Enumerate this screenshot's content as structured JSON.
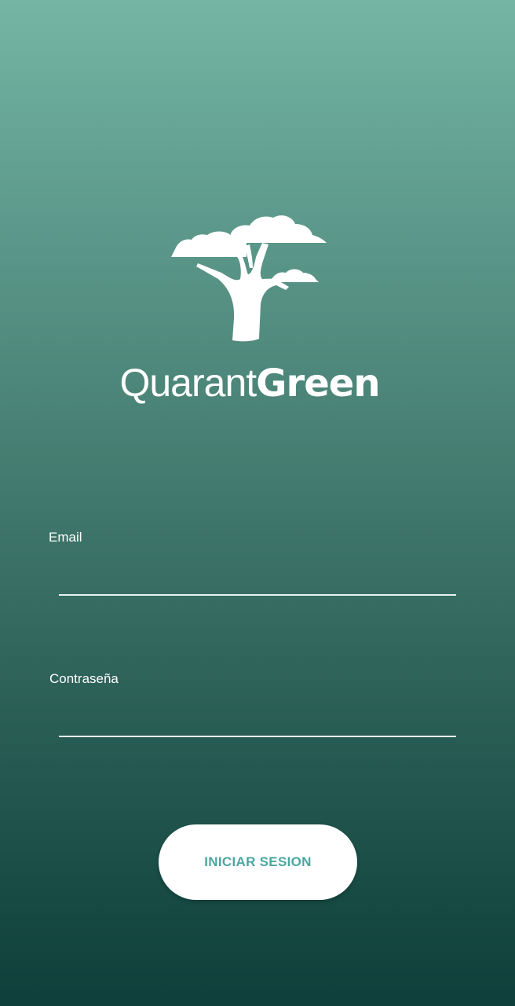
{
  "brand": {
    "name_light": "Quarant",
    "name_bold": "Green",
    "logo_icon": "baobab-tree-icon"
  },
  "form": {
    "email_label": "Email",
    "email_value": "",
    "password_label": "Contraseña",
    "password_value": ""
  },
  "actions": {
    "login_label": "INICIAR SESION"
  },
  "colors": {
    "gradient_top": "#74b6a3",
    "gradient_bottom": "#0f3f3a",
    "button_text": "#4aa7a0",
    "foreground": "#ffffff"
  }
}
